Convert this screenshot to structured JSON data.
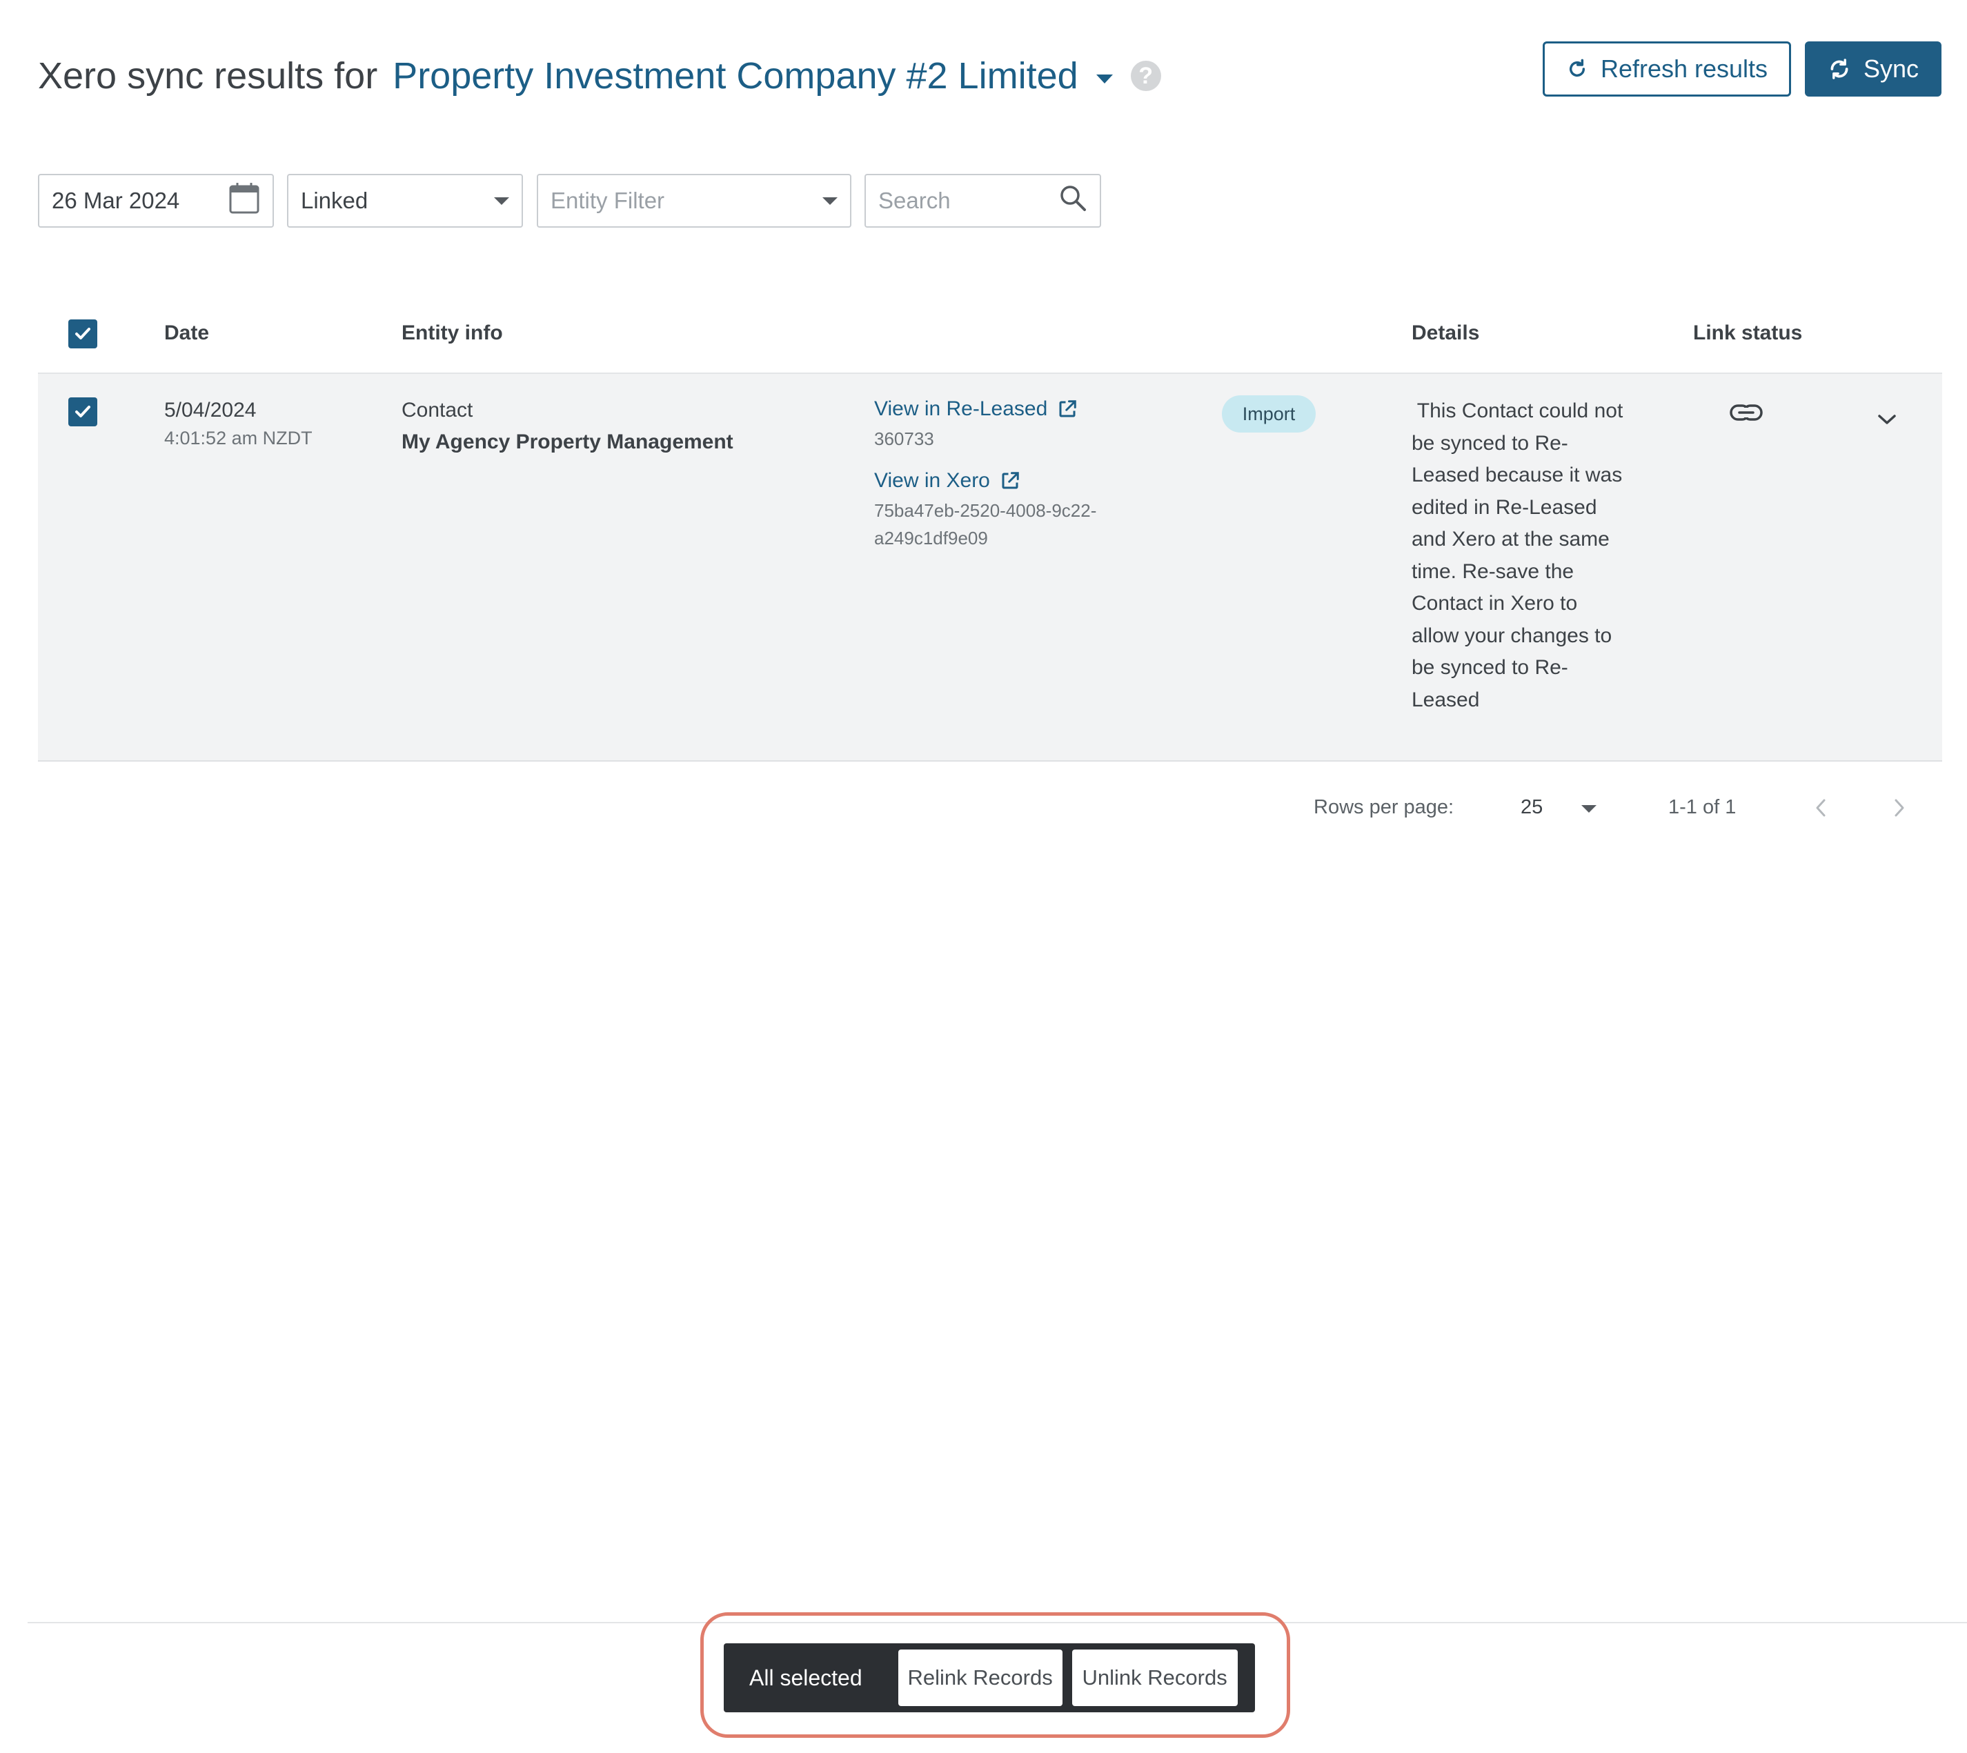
{
  "header": {
    "title_prefix": "Xero sync results for",
    "company_name": "Property Investment Company #2 Limited",
    "help_symbol": "?",
    "refresh_label": "Refresh results",
    "sync_label": "Sync"
  },
  "filters": {
    "date_value": "26 Mar 2024",
    "link_filter_value": "Linked",
    "entity_filter_placeholder": "Entity Filter",
    "search_placeholder": "Search"
  },
  "table": {
    "columns": {
      "date": "Date",
      "entity_info": "Entity info",
      "details": "Details",
      "link_status": "Link status"
    },
    "rows": [
      {
        "selected": true,
        "date": "5/04/2024",
        "time": "4:01:52 am NZDT",
        "entity_type": "Contact",
        "entity_name": "My Agency Property Management",
        "re_leased_link": "View in Re-Leased",
        "re_leased_id": "360733",
        "xero_link": "View in Xero",
        "xero_id_line1": "75ba47eb-2520-4008-9c22-",
        "xero_id_line2": "a249c1df9e09",
        "badge": "Import",
        "details_lines": [
          " This Contact could not",
          "be synced to Re-",
          "Leased because it was",
          "edited in Re-Leased",
          "and Xero at the same",
          "time. Re-save the",
          "Contact in Xero to",
          "allow your changes to",
          "be synced to Re-",
          "Leased"
        ],
        "link_status_icon": "link-icon"
      }
    ]
  },
  "pagination": {
    "rows_per_page_label": "Rows per page:",
    "rows_per_page_value": "25",
    "range": "1-1 of 1"
  },
  "bulk_actions": {
    "selection_label": "All selected",
    "relink_label": "Relink Records",
    "unlink_label": "Unlink Records"
  },
  "colors": {
    "brand": "#1f5d84",
    "link": "#1c5e86",
    "badge_bg": "#c8e9f1",
    "snackbar_bg": "#2c2f33",
    "highlight": "#e07d6c"
  }
}
